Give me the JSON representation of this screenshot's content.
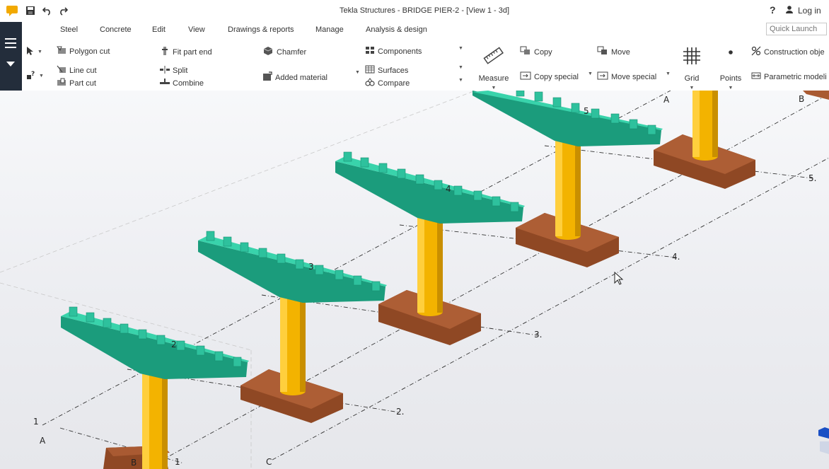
{
  "app": {
    "title": "Tekla Structures - BRIDGE PIER-2 - [View 1 - 3d]",
    "help": "?",
    "login_label": "Log in",
    "quick_launch_placeholder": "Quick Launch"
  },
  "tabs": [
    {
      "label": "Steel"
    },
    {
      "label": "Concrete"
    },
    {
      "label": "Edit",
      "active": true
    },
    {
      "label": "View"
    },
    {
      "label": "Drawings & reports"
    },
    {
      "label": "Manage"
    },
    {
      "label": "Analysis & design"
    }
  ],
  "ribbon": {
    "polygon_cut": "Polygon cut",
    "line_cut": "Line cut",
    "part_cut": "Part cut",
    "fit_part_end": "Fit part end",
    "split": "Split",
    "combine": "Combine",
    "chamfer": "Chamfer",
    "added_material": "Added material",
    "components": "Components",
    "surfaces": "Surfaces",
    "compare": "Compare",
    "measure": "Measure",
    "copy": "Copy",
    "copy_special": "Copy special",
    "move": "Move",
    "move_special": "Move special",
    "grid": "Grid",
    "points": "Points",
    "construction_objects": "Construction obje",
    "parametric_modeling": "Parametric modeli"
  },
  "viewport": {
    "piers": [
      "2",
      "3",
      "4",
      "5"
    ],
    "grid_number_labels": [
      "1",
      "1",
      "2.",
      "3.",
      "4.",
      "5."
    ],
    "grid_letter_labels": [
      "A",
      "A",
      "B",
      "B",
      "C"
    ],
    "colors": {
      "pier_cap": "#2fc49f",
      "column": "#f5b800",
      "footing": "#9a4f2c",
      "background": "#f3f4f6"
    }
  }
}
